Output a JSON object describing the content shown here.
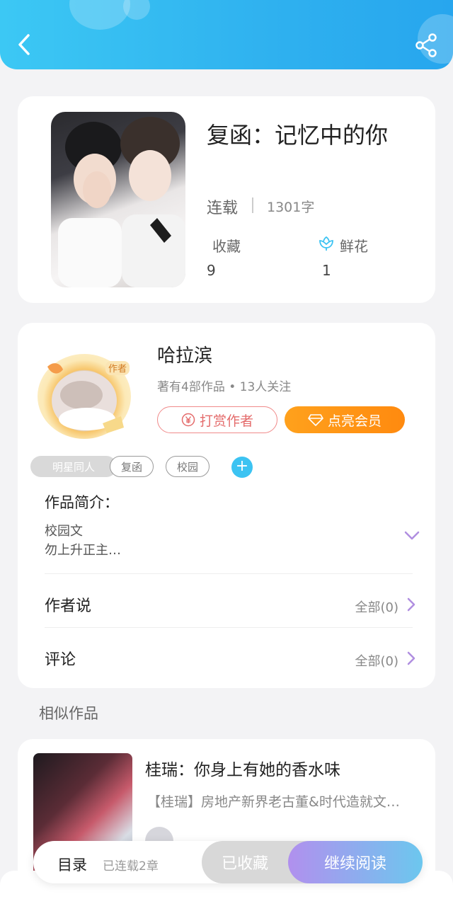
{
  "book": {
    "title": "复函：记忆中的你",
    "status": "连载",
    "words": "1301字",
    "favorites_label": "收藏",
    "favorites_value": "9",
    "flowers_label": "鲜花",
    "flowers_value": "1"
  },
  "author": {
    "name": "哈拉滨",
    "meta": "著有4部作品 • 13人关注",
    "avatar_badge": "作者",
    "tip_label": "打赏作者",
    "vip_label": "点亮会员"
  },
  "tags": [
    "明星同人",
    "复函",
    "校园"
  ],
  "intro": {
    "title": "作品简介：",
    "line1": "校园文",
    "line2": "勿上升正主…"
  },
  "rows": {
    "author_says": "作者说",
    "author_says_all": "全部(0)",
    "comments": "评论",
    "comments_all": "全部(0)"
  },
  "similar": {
    "heading": "相似作品",
    "title": "桂瑞：你身上有她的香水味",
    "desc": "【桂瑞】房地产新界老古董&时代造就文…"
  },
  "bottom": {
    "toc_label": "目录",
    "toc_count": "已连载2章",
    "collected_label": "已收藏",
    "read_label": "继续阅读"
  },
  "colors": {
    "header_gradient_start": "#3cc8f4",
    "header_gradient_end": "#27a6ee",
    "tip_border": "#f08a8a",
    "vip_orange": "#ff8a0f",
    "accent_blue": "#3cc3f2",
    "read_gradient_start": "#b190ee",
    "read_gradient_end": "#6cc7ee"
  },
  "icons": {
    "back": "back-arrow-icon",
    "share": "share-icon",
    "flower": "flower-icon",
    "expand": "chevron-down-icon",
    "row_arrow": "chevron-right-icon"
  }
}
